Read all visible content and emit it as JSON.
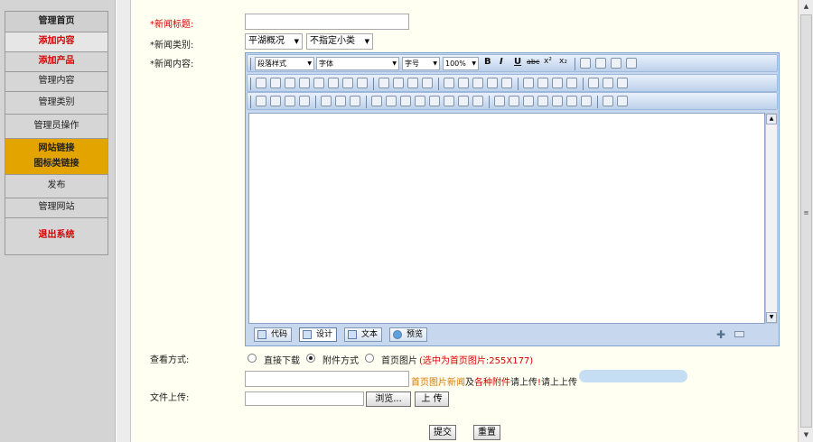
{
  "sidebar": {
    "items": [
      {
        "label": "管理首页"
      },
      {
        "label": "添加内容"
      },
      {
        "label": "添加产品"
      },
      {
        "label": "管理内容"
      },
      {
        "label": "管理类别"
      },
      {
        "label": "管理员操作"
      },
      {
        "label": "网站链接",
        "label2": "图标类链接"
      },
      {
        "label": "发布"
      },
      {
        "label": "管理网站"
      },
      {
        "label": "退出系统"
      }
    ]
  },
  "form": {
    "title_label": "*新闻标题:",
    "title_value": "",
    "category_label": "*新闻类别:",
    "category_main": "平湖概况",
    "category_sub": "不指定小类",
    "content_label": "*新闻内容:",
    "view_label": "查看方式:",
    "view_options": [
      "直接下载",
      "附件方式",
      "首页图片"
    ],
    "view_selected": "附件方式",
    "view_note": "(选中为首页图片:255X177)",
    "upload_label": "文件上传:",
    "hint_part1": "首页图片新闻",
    "hint_part2": "及",
    "hint_part3": "各种附件",
    "hint_part4": "请上传",
    "hint_part5": "!",
    "hint_part6": "请上上传",
    "browse_label": "浏览...",
    "upload_button": "上 传",
    "submit_button": "提交",
    "reset_button": "重置"
  },
  "editor": {
    "toolbar1": {
      "paragraph": "段落样式",
      "font": "字体",
      "size": "字号",
      "zoom": "100%",
      "bold": "B",
      "italic": "I",
      "underline": "U",
      "strike": "abc",
      "sup": "x²",
      "sub": "x₂"
    },
    "modes": [
      "代码",
      "设计",
      "文本",
      "预览"
    ],
    "active_mode": "设计"
  },
  "colors": {
    "accent_gold": "#e4a400",
    "nav_red": "#d50000",
    "hint_orange": "#d97a00"
  }
}
